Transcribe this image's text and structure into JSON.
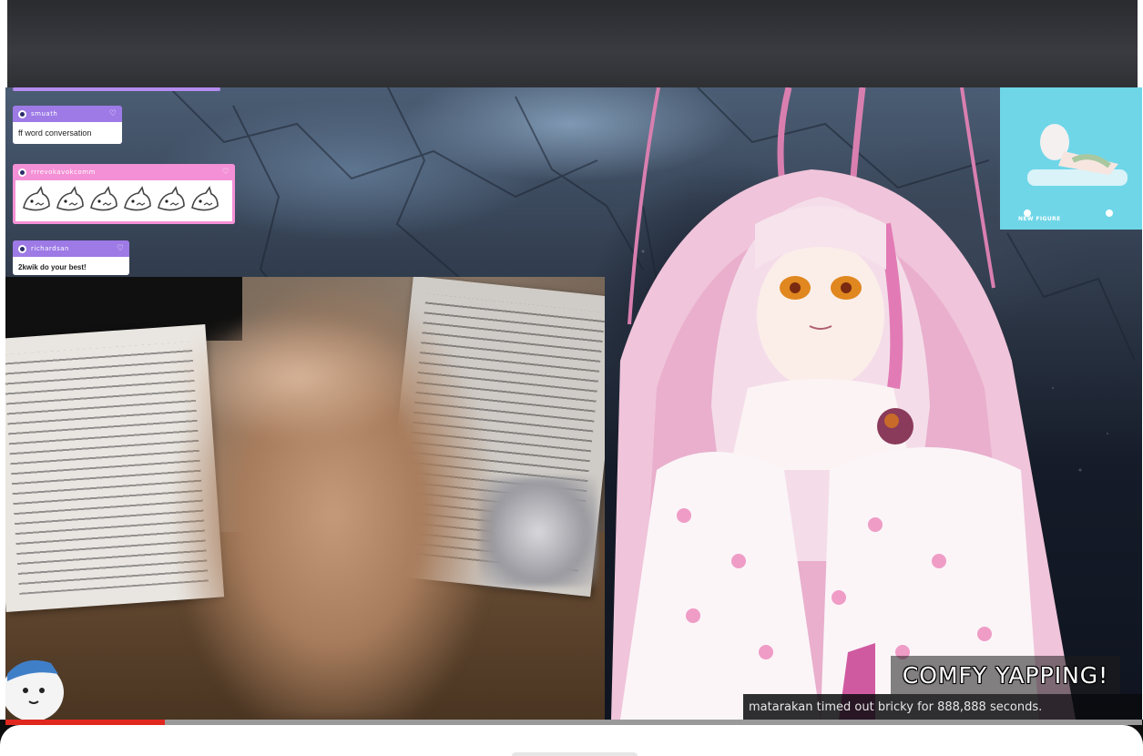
{
  "chat": {
    "messages": [
      {
        "user": "smuath",
        "text": "ff word conversation"
      },
      {
        "user": "rrrevokavokcomm",
        "emote": "shark-emote",
        "emote_count": 6
      },
      {
        "user": "richardsan",
        "text": "2kwik do your best!"
      }
    ]
  },
  "overlay": {
    "banner": "COMFY YAPPING!",
    "ticker": "matarakan timed out bricky for 888,888 seconds."
  },
  "promo": {
    "caption": "NEW FIGURE"
  },
  "player": {
    "progress": 0.14
  },
  "colors": {
    "accent_purple": "#9d7ae6",
    "accent_pink": "#f490d6",
    "progress_red": "#e1281f"
  }
}
